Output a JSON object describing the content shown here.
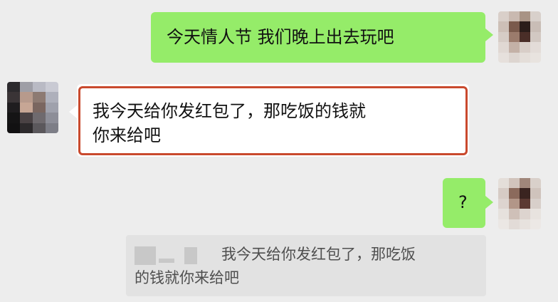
{
  "messages": [
    {
      "side": "right",
      "text": "今天情人节  我们晚上出去玩吧"
    },
    {
      "side": "left",
      "text_line1": "我今天给你发红包了，那吃饭的钱就",
      "text_line2": "你来给吧"
    },
    {
      "side": "right",
      "text": "?"
    }
  ],
  "quote": {
    "text_line1": "我今天给你发红包了，那吃饭",
    "text_line2": "的钱就你来给吧"
  },
  "colors": {
    "background": "#ededed",
    "self_bubble": "#95ec69",
    "other_bubble": "#ffffff",
    "highlight_border": "#c9492d",
    "quote_background": "#e2e2e2"
  },
  "icons": {
    "self_avatar": "blurred-avatar-icon",
    "other_avatar": "blurred-avatar-icon"
  }
}
